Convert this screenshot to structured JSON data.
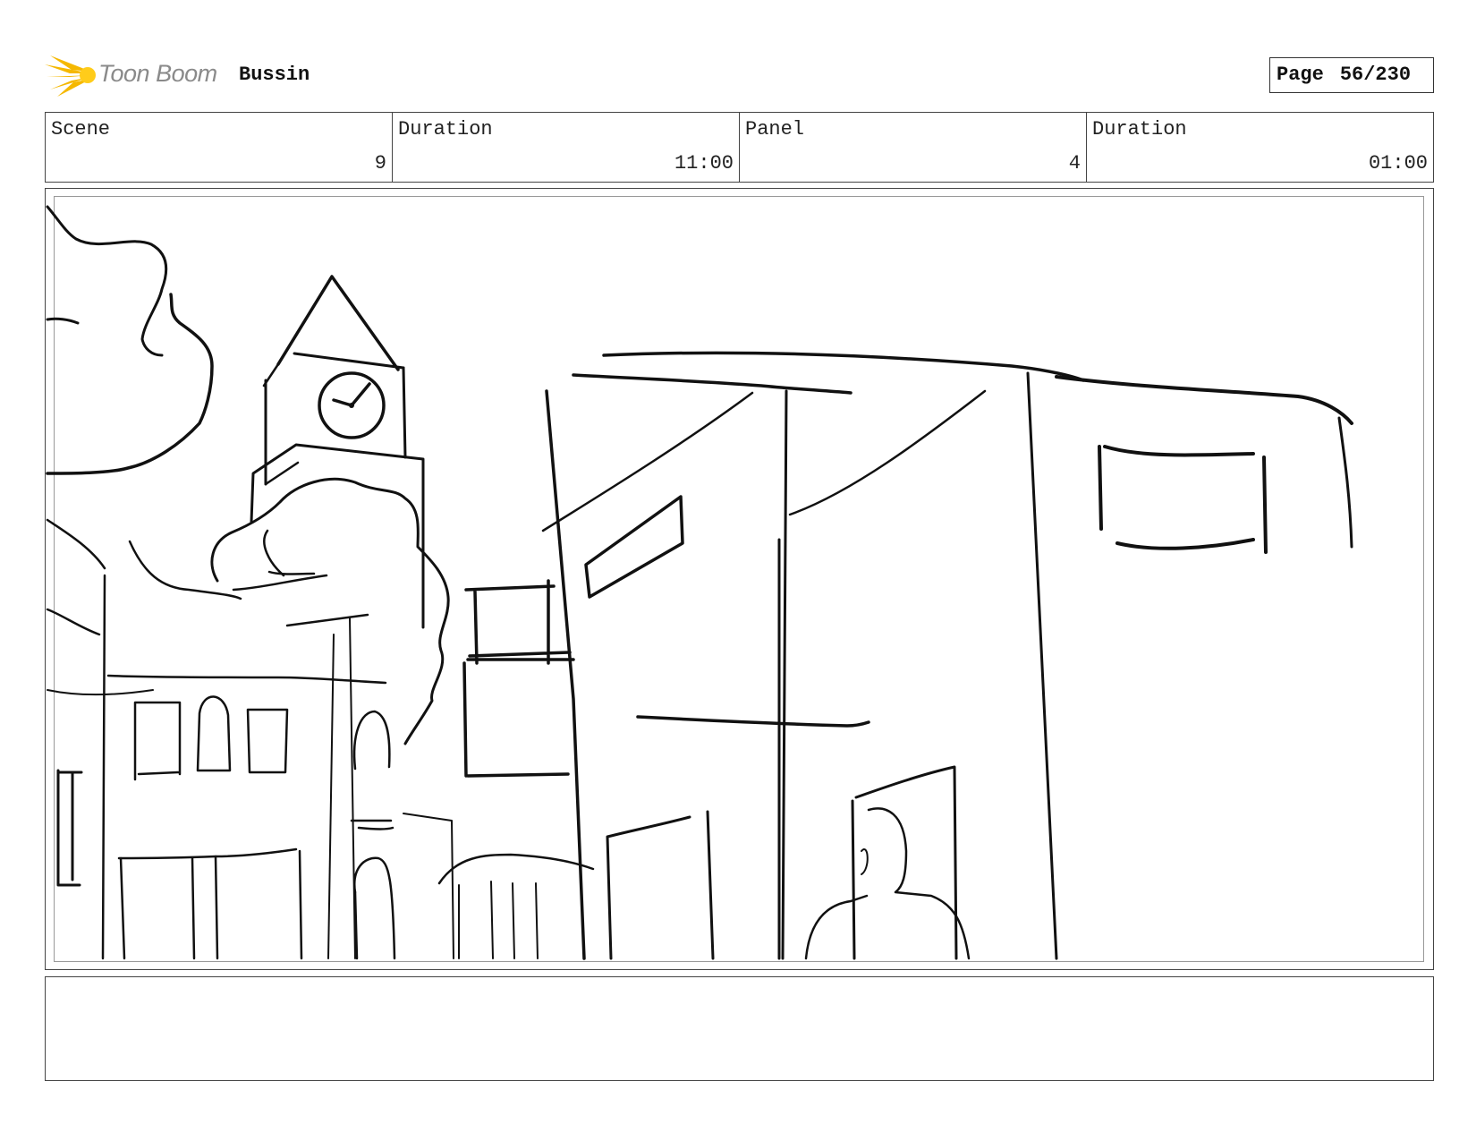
{
  "header": {
    "logo_text": "Toon Boom",
    "project_title": "Bussin",
    "page_label": "Page",
    "page_number": "56/230"
  },
  "info": {
    "scene_label": "Scene",
    "scene_value": "9",
    "scene_duration_label": "Duration",
    "scene_duration_value": "11:00",
    "panel_label": "Panel",
    "panel_value": "4",
    "panel_duration_label": "Duration",
    "panel_duration_value": "01:00"
  },
  "caption": {
    "text": ""
  },
  "colors": {
    "logo_star": "#f5b800",
    "logo_text": "#8a8a8a",
    "border": "#444444"
  }
}
